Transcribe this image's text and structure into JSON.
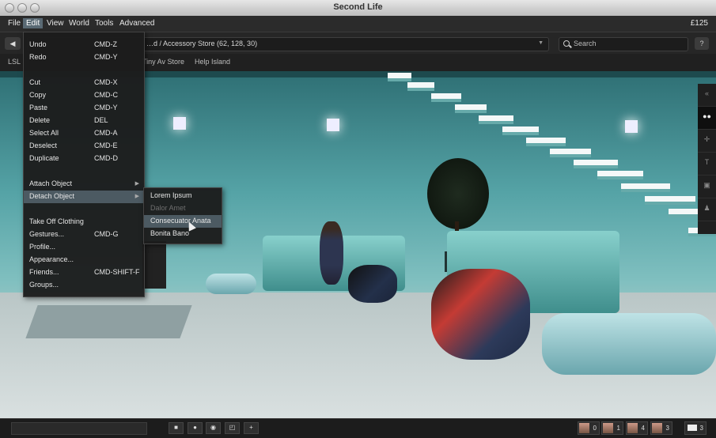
{
  "window": {
    "title": "Second Life"
  },
  "menubar": {
    "items": [
      "File",
      "Edit",
      "View",
      "World",
      "Tools",
      "Advanced"
    ],
    "active": "Edit",
    "balance": "£125"
  },
  "navbar": {
    "location": "…d / Accessory Store (62, 128, 30)",
    "search_placeholder": "Search",
    "back_glyph": "◀",
    "right_button_glyph": "?"
  },
  "favorites": {
    "items": [
      "LSL",
      "Tiny Av Store",
      "Help Island"
    ]
  },
  "edit_menu": {
    "items": [
      {
        "label": "Undo",
        "shortcut": "CMD-Z"
      },
      {
        "label": "Redo",
        "shortcut": "CMD-Y"
      },
      {
        "label": "Cut",
        "shortcut": "CMD-X"
      },
      {
        "label": "Copy",
        "shortcut": "CMD-C"
      },
      {
        "label": "Paste",
        "shortcut": "CMD-Y"
      },
      {
        "label": "Delete",
        "shortcut": "DEL"
      },
      {
        "label": "Select All",
        "shortcut": "CMD-A"
      },
      {
        "label": "Deselect",
        "shortcut": "CMD-E"
      },
      {
        "label": "Duplicate",
        "shortcut": "CMD-D"
      },
      {
        "label": "Attach Object",
        "shortcut": "",
        "submenu": true
      },
      {
        "label": "Detach Object",
        "shortcut": "",
        "submenu": true,
        "highlighted": true
      },
      {
        "label": "Take Off Clothing",
        "shortcut": ""
      },
      {
        "label": "Gestures...",
        "shortcut": "CMD-G"
      },
      {
        "label": "Profile...",
        "shortcut": ""
      },
      {
        "label": "Appearance...",
        "shortcut": ""
      },
      {
        "label": "Friends...",
        "shortcut": "CMD-SHIFT-F"
      },
      {
        "label": "Groups...",
        "shortcut": ""
      }
    ]
  },
  "detach_submenu": {
    "items": [
      {
        "label": "Lorem Ipsum",
        "disabled": false
      },
      {
        "label": "Dalor Amet",
        "disabled": true
      },
      {
        "label": "Consecuator Anata",
        "disabled": false,
        "highlighted": true
      },
      {
        "label": "Bonita Bano",
        "disabled": false
      }
    ]
  },
  "sidebar": {
    "icons": [
      "collapse-icon",
      "people-icon",
      "places-icon",
      "me-icon",
      "inventory-icon",
      "appearance-icon"
    ]
  },
  "bottombar": {
    "toolbar_icons": [
      "stop-icon",
      "record-icon",
      "camera-icon",
      "move-icon",
      "plus-icon"
    ],
    "people": [
      {
        "count": "0"
      },
      {
        "count": "1"
      },
      {
        "count": "4"
      },
      {
        "count": "3"
      }
    ],
    "messages_count": "3"
  }
}
